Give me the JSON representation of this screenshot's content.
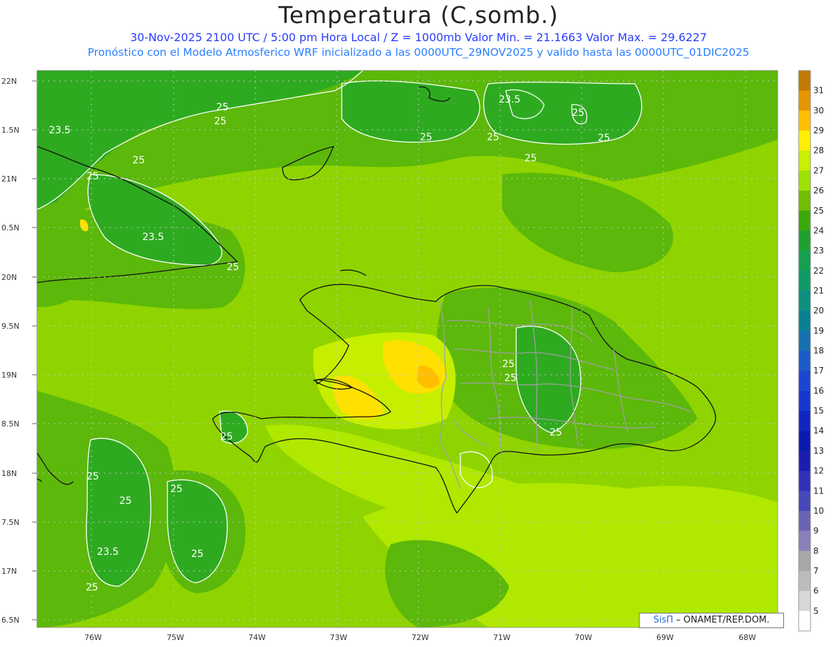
{
  "title": "Temperatura (C,somb.)",
  "subtitle_line1": "30-Nov-2025  2100 UTC / 5:00 pm Hora Local / Z = 1000mb   Valor Min. = 21.1663  Valor Max. = 29.6227",
  "subtitle_line2": "Pronóstico con el Modelo Atmosferico WRF inicializado a las 0000UTC_29NOV2025 y valido hasta las  0000UTC_01DIC2025",
  "credit_brand": "SisΠ",
  "credit_text": " – ONAMET/REP.DOM.",
  "lat_labels": [
    "22N",
    "1.5N",
    "21N",
    "0.5N",
    "20N",
    "9.5N",
    "19N",
    "8.5N",
    "18N",
    "7.5N",
    "17N",
    "6.5N"
  ],
  "lon_labels": [
    "76W",
    "75W",
    "74W",
    "73W",
    "72W",
    "71W",
    "70W",
    "69W",
    "68W"
  ],
  "colorbar": {
    "labels": [
      "31",
      "30",
      "29",
      "28",
      "27",
      "26",
      "25",
      "24",
      "23",
      "22",
      "21",
      "20",
      "19",
      "18",
      "17",
      "16",
      "15",
      "14",
      "13",
      "12",
      "11",
      "10",
      "9",
      "8",
      "7",
      "6",
      "5"
    ],
    "colors": [
      "#c07a00",
      "#e69500",
      "#ffbf00",
      "#fff000",
      "#c8f000",
      "#9ee000",
      "#70be00",
      "#3aa80a",
      "#20a030",
      "#15a050",
      "#109a68",
      "#0d9080",
      "#0a8090",
      "#1670b0",
      "#1b5cc8",
      "#1a47d0",
      "#1638d0",
      "#1026c0",
      "#0b1ab0",
      "#1c1cb0",
      "#3030b8",
      "#4848b8",
      "#6a64b4",
      "#8a80b8",
      "#a8a8a8",
      "#bcbcbc",
      "#d8d8d8",
      "#ffffff"
    ]
  },
  "contour_labels": [
    "25",
    "25",
    "23.5",
    "25",
    "25",
    "25",
    "23.5",
    "25",
    "25",
    "25",
    "25",
    "25",
    "23.5",
    "25",
    "25",
    "25",
    "25",
    "25",
    "25",
    "25",
    "25",
    "25",
    "25",
    "25",
    "25",
    "23.5",
    "25"
  ],
  "colors": {
    "background_field": "#8fd400",
    "cool_field": "#2eaa20",
    "mid_field": "#5cb80a",
    "warm_field": "#c6ef00",
    "hot_field": "#ffe000",
    "hotter_field": "#ffbe00",
    "coast": "#111111",
    "border": "#a0a0a0"
  }
}
